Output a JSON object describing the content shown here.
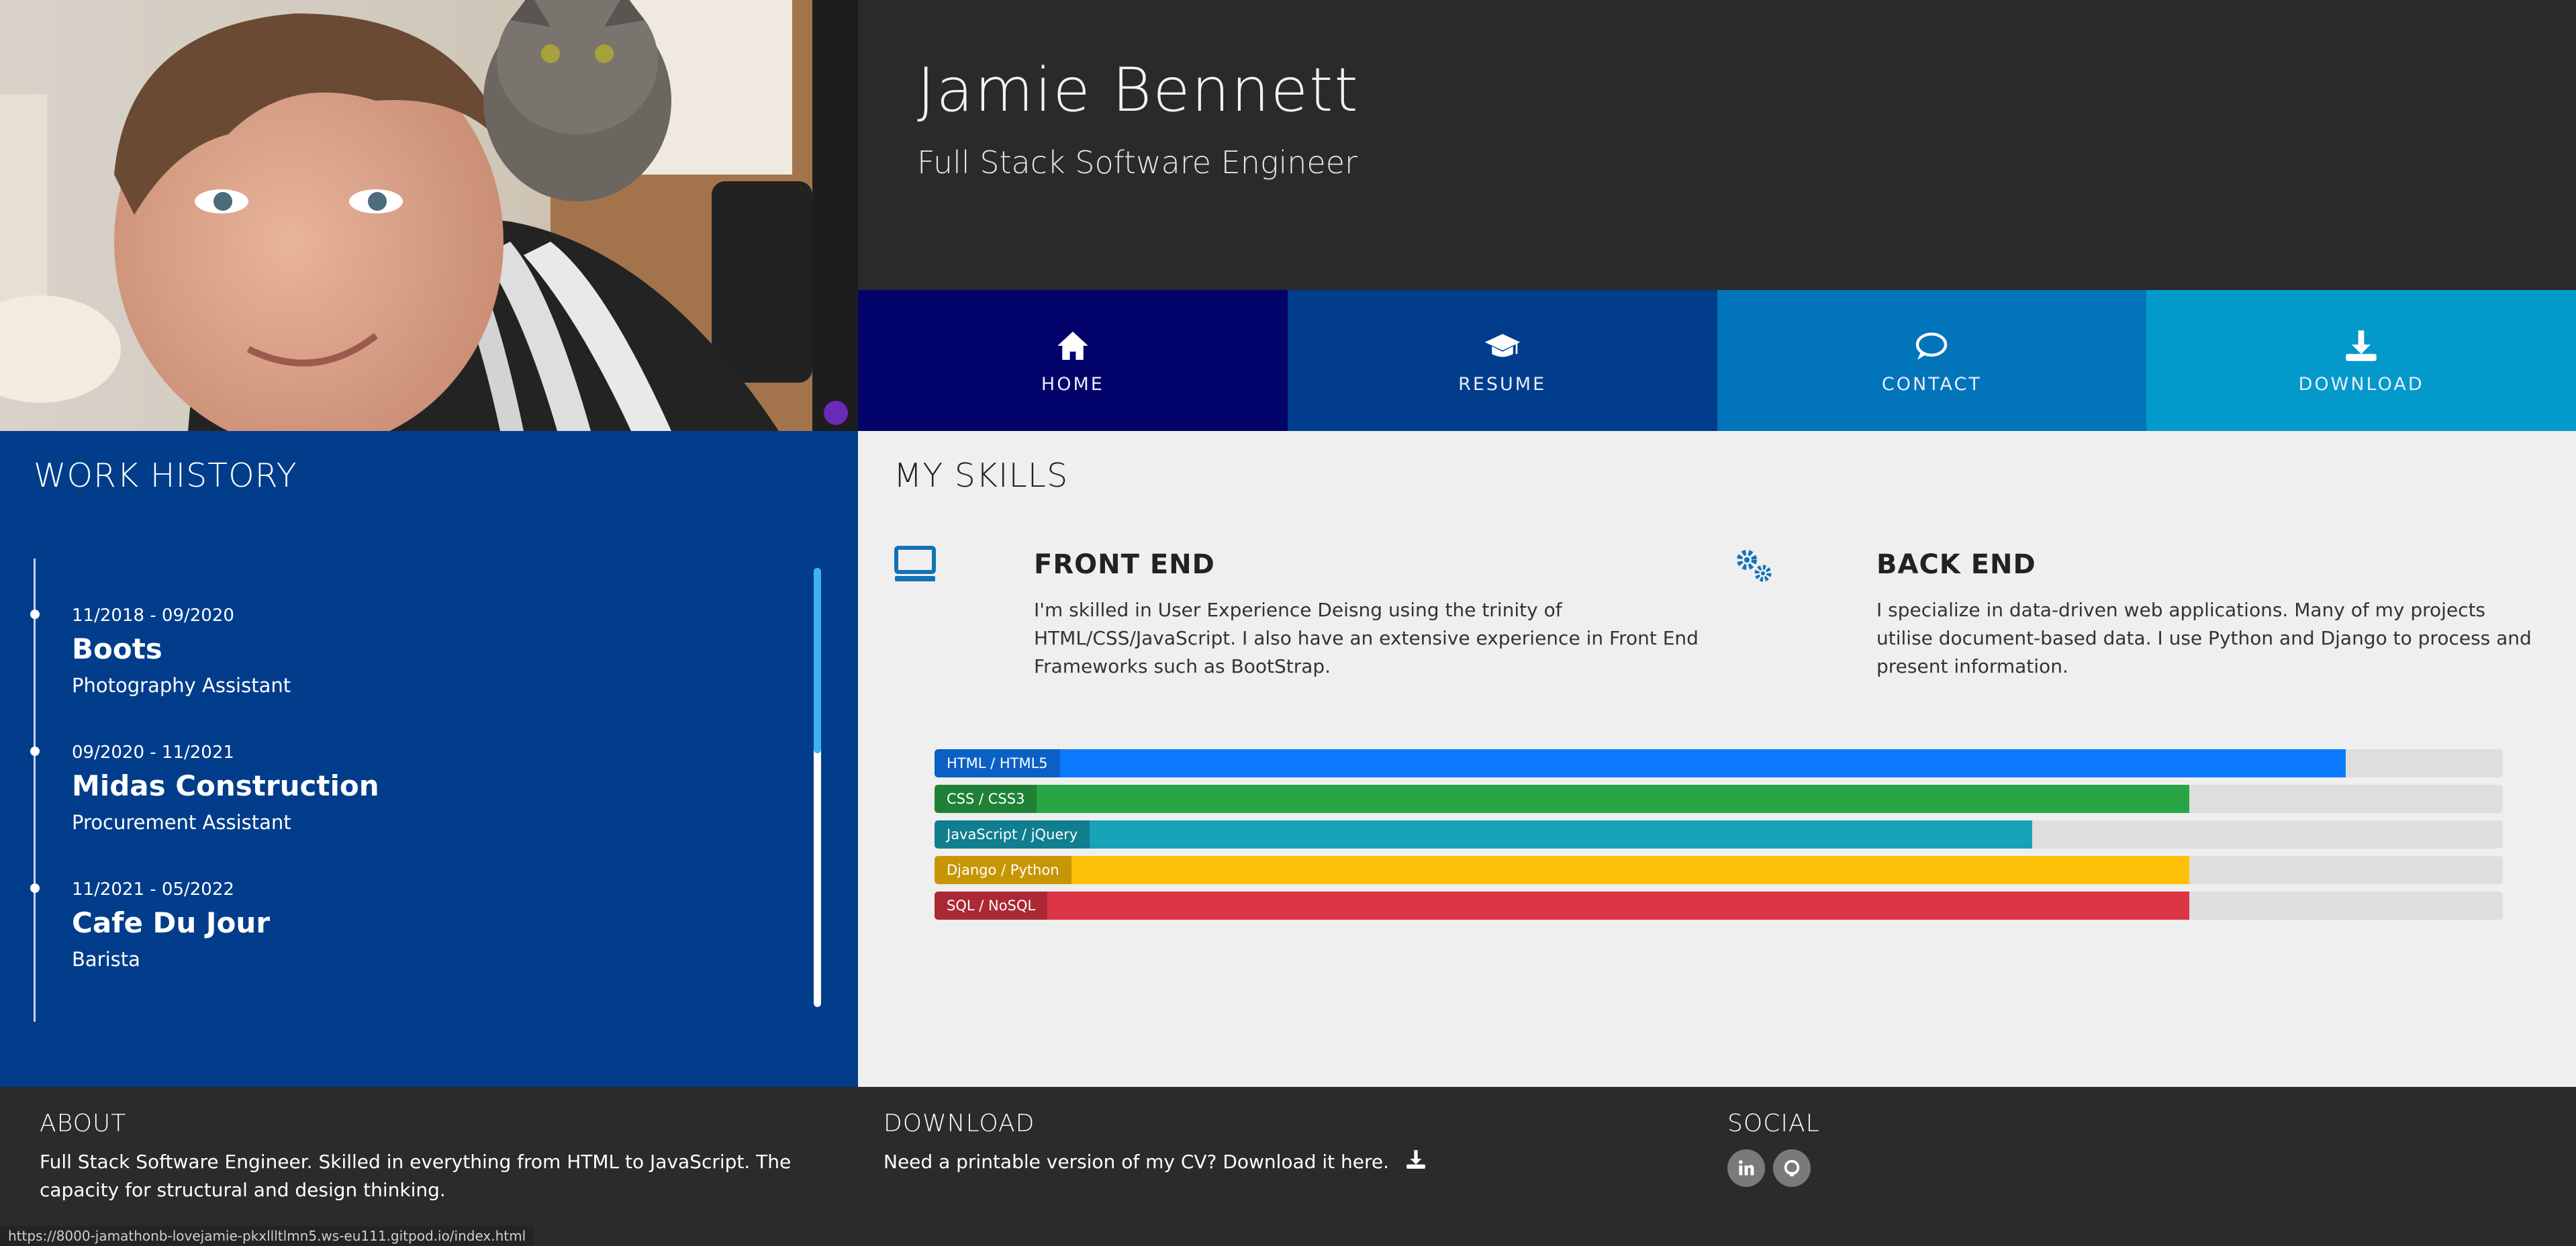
{
  "header": {
    "name": "Jamie Bennett",
    "title": "Full Stack Software Engineer"
  },
  "nav": [
    {
      "label": "HOME",
      "icon": "home-icon",
      "color": "#02036a"
    },
    {
      "label": "RESUME",
      "icon": "graduation-cap-icon",
      "color": "#013d8c"
    },
    {
      "label": "CONTACT",
      "icon": "chat-bubble-icon",
      "color": "#0174ba"
    },
    {
      "label": "DOWNLOAD",
      "icon": "download-icon",
      "color": "#0399ca"
    }
  ],
  "work_history": {
    "heading": "WORK HISTORY",
    "jobs": [
      {
        "date": "11/2018 - 09/2020",
        "company": "Boots",
        "role": "Photography Assistant"
      },
      {
        "date": "09/2020 - 11/2021",
        "company": "Midas Construction",
        "role": "Procurement Assistant"
      },
      {
        "date": "11/2021 - 05/2022",
        "company": "Cafe Du Jour",
        "role": "Barista"
      }
    ]
  },
  "skills": {
    "heading": "MY SKILLS",
    "front_end": {
      "icon": "monitor-icon",
      "title": "FRONT END",
      "text": "I'm skilled in User Experience Deisng using the trinity of HTML/CSS/JavaScript. I also have an extensive experience in Front End Frameworks such as BootStrap."
    },
    "back_end": {
      "icon": "gears-icon",
      "title": "BACK END",
      "text": "I specialize in data-driven web applications. Many of my projects utilise document-based data. I use Python and Django to process and present information."
    },
    "bars": [
      {
        "label": "HTML / HTML5",
        "percent": 90,
        "color": "#0d7bfd"
      },
      {
        "label": "CSS / CSS3",
        "percent": 80,
        "color": "#28a645"
      },
      {
        "label": "JavaScript / jQuery",
        "percent": 70,
        "color": "#17a2b8"
      },
      {
        "label": "Django / Python",
        "percent": 80,
        "color": "#ffc107"
      },
      {
        "label": "SQL / NoSQL",
        "percent": 80,
        "color": "#dc3545"
      }
    ]
  },
  "footer": {
    "about": {
      "heading": "ABOUT",
      "text": "Full Stack Software Engineer. Skilled in everything from HTML to JavaScript. The capacity for structural and design thinking."
    },
    "download": {
      "heading": "DOWNLOAD",
      "text": "Need a printable version of my CV? Download it here."
    },
    "social": {
      "heading": "SOCIAL",
      "links": [
        {
          "icon": "linkedin-icon"
        },
        {
          "icon": "github-icon"
        }
      ]
    }
  },
  "status_bar": {
    "url": "https://8000-jamathonb-lovejamie-pkxllltlmn5.ws-eu111.gitpod.io/index.html"
  }
}
